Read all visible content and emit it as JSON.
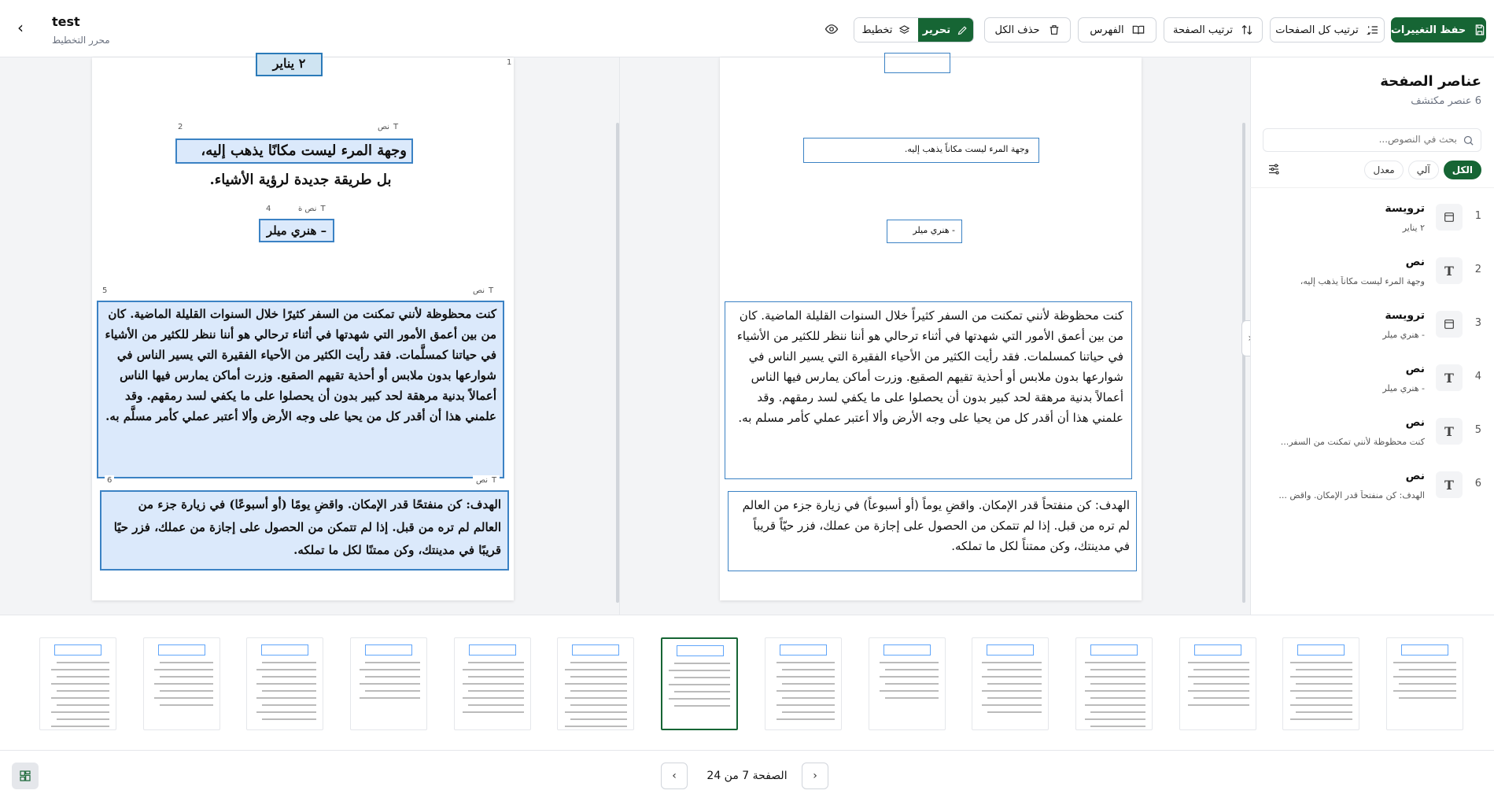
{
  "header": {
    "back_icon": "chevron-left-icon",
    "title": "test",
    "subtitle": "محرر التخطيط",
    "save": "حفظ التغييرات",
    "sort_all": "ترتيب كل الصفحات",
    "sort_page": "ترتيب الصفحة",
    "index": "الفهرس",
    "delete_all": "حذف الكل",
    "edit": "تحرير",
    "layout": "تخطيط",
    "preview_icon": "eye-icon",
    "accent_color": "#166534"
  },
  "left_page": {
    "top_fragment": "٢ يناير",
    "block_numbers": [
      "2",
      "4",
      "5",
      "6"
    ],
    "corner_number": "1",
    "tag_text": "نص",
    "tag_text_short": "نص ة",
    "line_a": "وجهة المرء ليست مكانًا يذهب إليه،",
    "line_b": "بل طريقة جديدة لرؤية الأشياء.",
    "author": "– هنري ميلر",
    "para1": "كنت محظوظة لأنني تمكنت من السفر كثيرًا خلال السنوات القليلة الماضية. كان من بين أعمق الأمور التي شهدتها في أثناء ترحالي هو أننا ننظر للكثير من الأشياء في حياتنا كمسلَّمات. فقد رأيت الكثير من الأحياء الفقيرة التي يسير الناس في شوارعها بدون ملابس أو أحذية تقيهم الصقيع. وزرت أماكن يمارس فيها الناس أعمالاً بدنية مرهقة لحد كبير بدون أن يحصلوا على ما يكفي لسد رمقهم. وقد علمني هذا أن أقدر كل من يحيا على وجه الأرض وألا أعتبر عملي كأمر مسلَّم به.",
    "para2": "الهدف: كن منفتحًا قدر الإمكان. واقضِ يومًا (أو أسبوعًا) في زيارة جزء من العالم لم تره من قبل. إذا لم تتمكن من الحصول على إجازة من عملك، فزر حيًا قريبًا في مدينتك، وكن ممتنًا لكل ما تملكه."
  },
  "right_page": {
    "quote": "وجهة المرء ليست مكاناً يذهب إليه.",
    "author": "- هنري ميلر",
    "para1": "كنت محظوظة لأنني تمكنت من السفر كثيراً خلال السنوات القليلة الماضية. كان من بين أعمق الأمور التي شهدتها في أثناء ترحالي هو أننا ننظر للكثير من الأشياء في حياتنا كمسلمات. فقد رأيت الكثير من الأحياء الفقيرة التي يسير الناس في شوارعها بدون ملابس أو أحذية تقيهم الصقيع. وزرت أماكن يمارس فيها الناس أعمالاً بدنية مرهقة لحد كبير بدون أن يحصلوا على ما يكفي لسد رمقهم. وقد علمني هذا أن أقدر كل من يحيا على وجه الأرض وألا أعتبر عملي كأمر مسلم به.",
    "para2": "الهدف: كن منفتحاً قدر الإمكان. واقضِ يوماً (أو أسبوعاً) في زيارة جزء من العالم لم تره من قبل. إذا لم تتمكن من الحصول على إجازة من عملك، فزر حيّاً قريباً في مدينتك، وكن ممتناً لكل ما تملكه."
  },
  "sidebar": {
    "title": "عناصر الصفحة",
    "count": "6 عنصر مكتشف",
    "search_placeholder": "بحث في النصوص...",
    "filters": [
      "الكل",
      "آلي",
      "معدل"
    ],
    "items": [
      {
        "num": "1",
        "type": "ترويسة",
        "icon": "header-icon",
        "preview": "٢ يناير"
      },
      {
        "num": "2",
        "type": "نص",
        "icon": "text-icon",
        "preview": "وجهة المرء ليست مكاناً يذهب إليه،"
      },
      {
        "num": "3",
        "type": "ترويسة",
        "icon": "header-icon",
        "preview": "- هنري ميلر"
      },
      {
        "num": "4",
        "type": "نص",
        "icon": "text-icon",
        "preview": "- هنري ميلر"
      },
      {
        "num": "5",
        "type": "نص",
        "icon": "text-icon",
        "preview": "كنت محظوظة لأنني تمكنت من السفر..."
      },
      {
        "num": "6",
        "type": "نص",
        "icon": "text-icon",
        "preview": "الهدف: كن منفتحاً قدر الإمكان. واقضِ ..."
      }
    ]
  },
  "thumbnails": {
    "count": 14,
    "current_index": 7
  },
  "footer": {
    "page_label": "الصفحة 7 من 24",
    "prev_icon": "chevron-left-icon",
    "next_icon": "chevron-right-icon",
    "grid_icon": "layout-grid-icon"
  }
}
